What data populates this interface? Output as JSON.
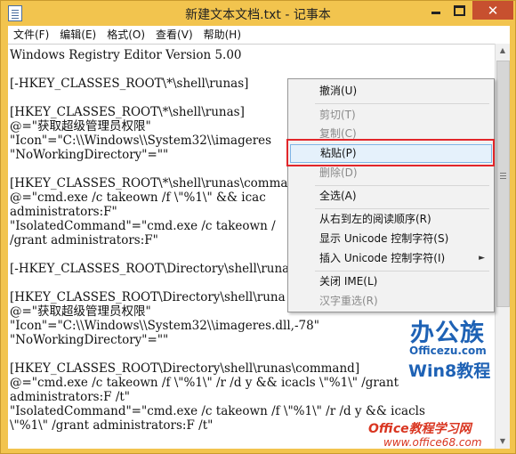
{
  "window": {
    "title": "新建文本文档.txt - 记事本",
    "close_symbol": "✕",
    "accent_color": "#f2c44e",
    "close_color": "#c7502f"
  },
  "menubar": {
    "items": [
      "文件(F)",
      "编辑(E)",
      "格式(O)",
      "查看(V)",
      "帮助(H)"
    ]
  },
  "editor": {
    "lines": [
      "Windows Registry Editor Version 5.00",
      "",
      "[-HKEY_CLASSES_ROOT\\*\\shell\\runas]",
      "",
      "[HKEY_CLASSES_ROOT\\*\\shell\\runas]",
      "@=\"获取超级管理员权限\"",
      "\"Icon\"=\"C:\\\\Windows\\\\System32\\\\imageres",
      "\"NoWorkingDirectory\"=\"\"",
      "",
      "[HKEY_CLASSES_ROOT\\*\\shell\\runas\\command",
      "@=\"cmd.exe /c takeown /f \\\"%1\\\" && icac",
      "administrators:F\"",
      "\"IsolatedCommand\"=\"cmd.exe /c takeown /",
      "/grant administrators:F\"",
      "",
      "[-HKEY_CLASSES_ROOT\\Directory\\shell\\runa",
      "",
      "[HKEY_CLASSES_ROOT\\Directory\\shell\\runa",
      "@=\"获取超级管理员权限\"",
      "\"Icon\"=\"C:\\\\Windows\\\\System32\\\\imageres.dll,-78\"",
      "\"NoWorkingDirectory\"=\"\"",
      "",
      "[HKEY_CLASSES_ROOT\\Directory\\shell\\runas\\command]",
      "@=\"cmd.exe /c takeown /f \\\"%1\\\" /r /d y && icacls \\\"%1\\\" /grant",
      "administrators:F /t\"",
      "\"IsolatedCommand\"=\"cmd.exe /c takeown /f \\\"%1\\\" /r /d y && icacls",
      "\\\"%1\\\" /grant administrators:F /t\""
    ]
  },
  "context_menu": {
    "items": [
      {
        "label": "撤消(U)",
        "enabled": true
      },
      {
        "label": "剪切(T)",
        "enabled": false
      },
      {
        "label": "复制(C)",
        "enabled": false
      },
      {
        "label": "粘贴(P)",
        "enabled": true,
        "highlighted": true
      },
      {
        "label": "删除(D)",
        "enabled": false
      },
      {
        "label": "全选(A)",
        "enabled": true
      },
      {
        "label": "从右到左的阅读顺序(R)",
        "enabled": true
      },
      {
        "label": "显示 Unicode 控制字符(S)",
        "enabled": true
      },
      {
        "label": "插入 Unicode 控制字符(I)",
        "enabled": true,
        "submenu": true
      },
      {
        "label": "关闭 IME(L)",
        "enabled": true
      },
      {
        "label": "汉字重选(R)",
        "enabled": false
      }
    ],
    "submenu_arrow": "►",
    "highlight_box_color": "#e2262a"
  },
  "watermark": {
    "title": "办公族",
    "site": "Officezu.com",
    "subtitle": "Win8教程",
    "bottom": "Office教程学习网",
    "url": "www.office68.com"
  }
}
